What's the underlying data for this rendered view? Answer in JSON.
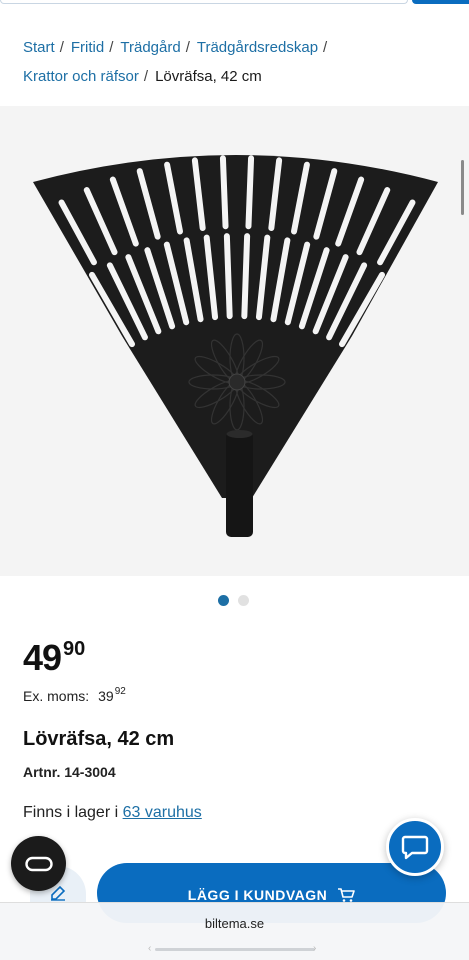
{
  "breadcrumb": {
    "items": [
      "Start",
      "Fritid",
      "Trädgård",
      "Trädgårdsredskap",
      "Krattor och räfsor"
    ],
    "separator": "/",
    "current": "Lövräfsa, 42 cm"
  },
  "gallery": {
    "image_icon": "rake-product-image",
    "slide_count": 2,
    "active_slide": 1
  },
  "product": {
    "price_int": "49",
    "price_dec": "90",
    "ex_moms_label": "Ex. moms:",
    "ex_moms_int": "39",
    "ex_moms_dec": "92",
    "title": "Lövräfsa, 42 cm",
    "artnr": "Artnr. 14-3004"
  },
  "stock": {
    "prefix": "Finns i lager i",
    "link": "63 varuhus"
  },
  "actions": {
    "cart_label": "LÄGG I KUNDVAGN",
    "cart_icon": "cart-icon",
    "ar_icon": "ar-view-icon",
    "chat_icon": "chat-icon",
    "edit_icon": "edit-icon"
  },
  "browser": {
    "url": "biltema.se"
  },
  "colors": {
    "accent": "#0a6cbf",
    "link": "#1d6fa5",
    "image_bg": "#f4f4f4"
  }
}
